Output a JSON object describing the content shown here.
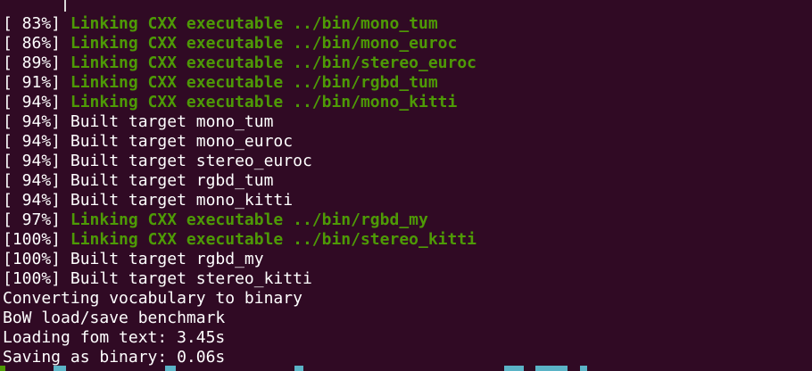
{
  "terminal": {
    "top_marker": "^~~~~~~~~~",
    "lines": [
      {
        "prefix": "[ 83%] ",
        "text": "Linking CXX executable ../bin/mono_tum",
        "style": "link"
      },
      {
        "prefix": "[ 86%] ",
        "text": "Linking CXX executable ../bin/mono_euroc",
        "style": "link"
      },
      {
        "prefix": "[ 89%] ",
        "text": "Linking CXX executable ../bin/stereo_euroc",
        "style": "link"
      },
      {
        "prefix": "[ 91%] ",
        "text": "Linking CXX executable ../bin/rgbd_tum",
        "style": "link"
      },
      {
        "prefix": "[ 94%] ",
        "text": "Linking CXX executable ../bin/mono_kitti",
        "style": "link"
      },
      {
        "prefix": "[ 94%] ",
        "text": "Built target mono_tum",
        "style": "plain"
      },
      {
        "prefix": "[ 94%] ",
        "text": "Built target mono_euroc",
        "style": "plain"
      },
      {
        "prefix": "[ 94%] ",
        "text": "Built target stereo_euroc",
        "style": "plain"
      },
      {
        "prefix": "[ 94%] ",
        "text": "Built target rgbd_tum",
        "style": "plain"
      },
      {
        "prefix": "[ 94%] ",
        "text": "Built target mono_kitti",
        "style": "plain"
      },
      {
        "prefix": "[ 97%] ",
        "text": "Linking CXX executable ../bin/rgbd_my",
        "style": "link"
      },
      {
        "prefix": "[100%] ",
        "text": "Linking CXX executable ../bin/stereo_kitti",
        "style": "link"
      },
      {
        "prefix": "[100%] ",
        "text": "Built target rgbd_my",
        "style": "plain"
      },
      {
        "prefix": "[100%] ",
        "text": "Built target stereo_kitti",
        "style": "plain"
      },
      {
        "prefix": "",
        "text": "Converting vocabulary to binary",
        "style": "plain"
      },
      {
        "prefix": "",
        "text": "BoW load/save benchmark",
        "style": "plain"
      },
      {
        "prefix": "",
        "text": "Loading fom text: 3.45s",
        "style": "plain"
      },
      {
        "prefix": "",
        "text": "Saving as binary: 0.06s",
        "style": "plain"
      }
    ]
  },
  "colors": {
    "background": "#300a24",
    "link_green": "#4e9a06",
    "text_white": "#ffffff",
    "marker_cyan": "#5ab3c6"
  }
}
